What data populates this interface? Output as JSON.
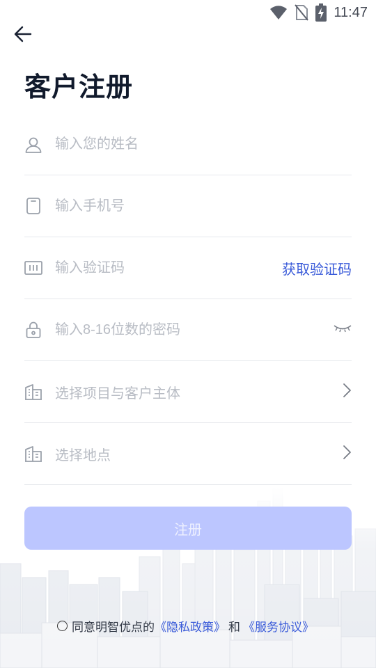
{
  "status_bar": {
    "time": "11:47",
    "icons": [
      "wifi-icon",
      "no-sim-icon",
      "battery-charging-icon"
    ]
  },
  "header": {
    "back_icon": "arrow-left-icon",
    "title": "客户注册"
  },
  "form": {
    "name": {
      "placeholder": "输入您的姓名",
      "icon": "user-icon"
    },
    "phone": {
      "placeholder": "输入手机号",
      "icon": "phone-icon"
    },
    "code": {
      "placeholder": "输入验证码",
      "icon": "code-icon",
      "action": "获取验证码"
    },
    "password": {
      "placeholder": "输入8-16位数的密码",
      "icon": "lock-icon",
      "toggle_icon": "eye-closed-icon"
    },
    "project": {
      "placeholder": "选择项目与客户主体",
      "icon": "building-icon"
    },
    "location": {
      "placeholder": "选择地点",
      "icon": "building-icon"
    }
  },
  "register_button": {
    "label": "注册"
  },
  "agreement": {
    "text": "同意明智优点的",
    "privacy_link": "《隐私政策》",
    "and": "和",
    "service_link": "《服务协议》"
  },
  "colors": {
    "accent": "#3a5bd9",
    "button_disabled": "#bcc6ff",
    "divider": "#e6e8ec"
  }
}
